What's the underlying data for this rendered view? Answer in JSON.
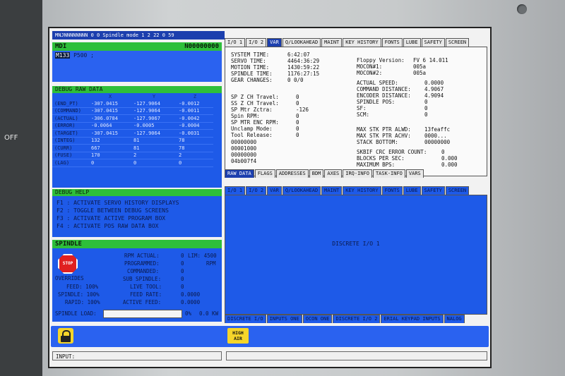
{
  "status_bar": {
    "text": "MNJNNNNNNNN   0   0 Spindle mode 1 2 22   0  59"
  },
  "mdi": {
    "title": "MDI",
    "program": "N00000000",
    "line_highlight": "M133",
    "line_rest": " P500 ;"
  },
  "debug_raw": {
    "title": "DEBUG RAW DATA",
    "columns": [
      "",
      "X",
      "Y",
      "Z"
    ],
    "rows": [
      {
        "label": "(END_PT)",
        "x": "-307.0415",
        "y": "-127.9064",
        "z": "-0.0012"
      },
      {
        "label": "(COMMAND)",
        "x": "-307.0415",
        "y": "-127.9064",
        "z": "-0.0011"
      },
      {
        "label": "(ACTUAL)",
        "x": "-306.0784",
        "y": "-127.9067",
        "z": "-0.0042"
      },
      {
        "label": "(ERROR)",
        "x": "-0.0064",
        "y": "-0.0005",
        "z": "-0.0004"
      },
      {
        "label": "(TARGET)",
        "x": "-307.0415",
        "y": "-127.9064",
        "z": "-0.0031"
      },
      {
        "label": "(INTEG)",
        "x": "132",
        "y": "81",
        "z": "78"
      },
      {
        "label": "(CURR)",
        "x": "667",
        "y": "81",
        "z": "78"
      },
      {
        "label": "(FUSE)",
        "x": "170",
        "y": "2",
        "z": "2"
      },
      {
        "label": "(LAG)",
        "x": "0",
        "y": "0",
        "z": "0"
      }
    ]
  },
  "debug_help": {
    "title": "DEBUG HELP",
    "lines": [
      "F1 : ACTIVATE SERVO HISTORY DISPLAYS",
      "F2 : TOGGLE BETWEEN DEBUG SCREENS",
      "F3 : ACTIVATE ACTIVE PROGRAM BOX",
      "F4 : ACTIVATE POS RAW DATA BOX"
    ]
  },
  "spindle": {
    "title": "SPINDLE",
    "stop_label": "STOP",
    "overrides_label": "OVERRIDES",
    "feed": "FEED: 100%",
    "spindle": "SPINDLE: 100%",
    "rapid": "RAPID: 100%",
    "rpm_actual_label": "RPM ACTUAL:",
    "rpm_actual_value": "0",
    "lim": "LIM: 4500",
    "programmed_label": "PROGRAMMED:",
    "programmed_value": "0",
    "rpm_unit": "RPM",
    "commanded_label": "COMMANDED:",
    "commanded_value": "0",
    "sub_spindle_label": "SUB SPINDLE:",
    "sub_spindle_value": "0",
    "live_tool_label": "LIVE TOOL:",
    "live_tool_value": "0",
    "feed_rate_label": "FEED RATE:",
    "feed_rate_value": "0.0000",
    "active_feed_label": "ACTIVE FEED:",
    "active_feed_value": "0.0000",
    "load_label": "SPINDLE LOAD:",
    "load_pct": "0%",
    "load_kw": "0.0 KW"
  },
  "top_tabs": [
    "I/O 1",
    "I/O 2",
    "VAR",
    "Q/LOOKAHEAD",
    "MAINT",
    "KEY HISTORY",
    "FONTS",
    "LUBE",
    "SAFETY",
    "SCREEN"
  ],
  "top_active_tab": "VAR",
  "var": {
    "left1": [
      {
        "label": "SYSTEM TIME:",
        "value": "6:42:07"
      },
      {
        "label": "SERVO TIME:",
        "value": "4464:36:29"
      },
      {
        "label": "MOTION TIME:",
        "value": "1430:59:22"
      },
      {
        "label": "SPINDLE TIME:",
        "value": "1176:27:15"
      },
      {
        "label": "GEAR CHANGES:",
        "value": "0 0/0"
      }
    ],
    "left2": [
      {
        "label": "SP Z CH Travel:",
        "value": "0"
      },
      {
        "label": "SS Z CH Travel:",
        "value": "0"
      },
      {
        "label": "SP Mtr Zctra:",
        "value": "-126"
      },
      {
        "label": "Spin RPM:",
        "value": "0"
      },
      {
        "label": "SP MTR ENC RPM:",
        "value": "0"
      },
      {
        "label": "Unclamp Mode:",
        "value": "0"
      },
      {
        "label": "Tool Release:",
        "value": "0"
      }
    ],
    "hex": [
      "00000000",
      "00001000",
      "00000000",
      "04b007f4"
    ],
    "right1": [
      {
        "label": "Floppy Version:",
        "value": "FV 6  14.011"
      },
      {
        "label": "MOCON#1:",
        "value": "005a"
      },
      {
        "label": "MOCON#2:",
        "value": "005a"
      }
    ],
    "right2": [
      {
        "label": "ACTUAL SPEED:",
        "value": "0.0000"
      },
      {
        "label": "COMMAND DISTANCE:",
        "value": "4.9067"
      },
      {
        "label": "ENCODER DISTANCE:",
        "value": "4.9094"
      },
      {
        "label": "SPINDLE POS:",
        "value": "0"
      },
      {
        "label": "SF:",
        "value": "0"
      },
      {
        "label": "SCM:",
        "value": "0"
      }
    ],
    "right3": [
      {
        "label": "MAX STK PTR ALWD:",
        "value": "13feaffc"
      },
      {
        "label": "MAX STK PTR ACHV:",
        "value": "0000..."
      },
      {
        "label": "STACK BOTTOM:",
        "value": "00000000"
      }
    ],
    "right4": [
      {
        "label": "SKBIF CRC ERROR COUNT:",
        "value": "0"
      },
      {
        "label": "BLOCKS PER SEC:",
        "value": "0.000"
      },
      {
        "label": "MAXIMUM BPS:",
        "value": "0.000"
      }
    ]
  },
  "var_subtabs": [
    "RAW DATA",
    "FLAGS",
    "ADDRESSES",
    "BDM",
    "AXES",
    "IRQ-INFO",
    "TASK-INFO",
    "VARS"
  ],
  "lower_tabs": [
    "I/O 1",
    "I/O 2",
    "VAR",
    "Q/LOOKAHEAD",
    "MAINT",
    "KEY HISTORY",
    "FONTS",
    "LUBE",
    "SAFETY",
    "SCREEN"
  ],
  "discrete_label": "DISCRETE I/O 1",
  "discrete_subtabs": [
    "DISCRETE I/O",
    "INPUTS ONE",
    "OCON ONE",
    "DISCRETE I/O 2",
    "ERIAL KEYPAD INPUTS",
    "NALOG"
  ],
  "high_air": "HIGH AIR",
  "input_label": "INPUT:"
}
